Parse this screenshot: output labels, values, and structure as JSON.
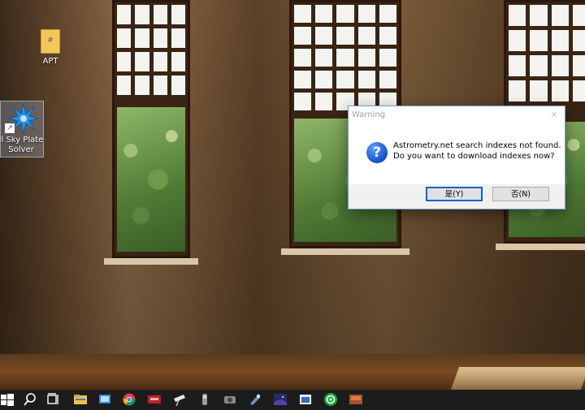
{
  "desktop": {
    "icons": [
      {
        "label": "APT"
      },
      {
        "label": "ll Sky Plate\nSolver"
      }
    ]
  },
  "dialog": {
    "title": "Warning",
    "close_glyph": "✕",
    "icon_glyph": "?",
    "message_line1": "Astrometry.net search indexes not found.",
    "message_line2": "Do you want to download indexes now?",
    "yes_label": "是(Y)",
    "no_label": "否(N)"
  },
  "taskbar": {
    "items": [
      "windows-start-icon",
      "search-icon",
      "task-view-icon",
      "file-explorer-icon",
      "screen-app-icon",
      "chrome-icon",
      "asi-app-icon",
      "telescope-app-icon",
      "focuser-app-icon",
      "camera-app-icon",
      "mount-app-icon",
      "sky-app-icon",
      "window-app-icon",
      "green-circle-app-icon",
      "stellarium-app-icon"
    ]
  },
  "colors": {
    "accent": "#0a63c9",
    "taskbar": "#1c1c1c"
  }
}
